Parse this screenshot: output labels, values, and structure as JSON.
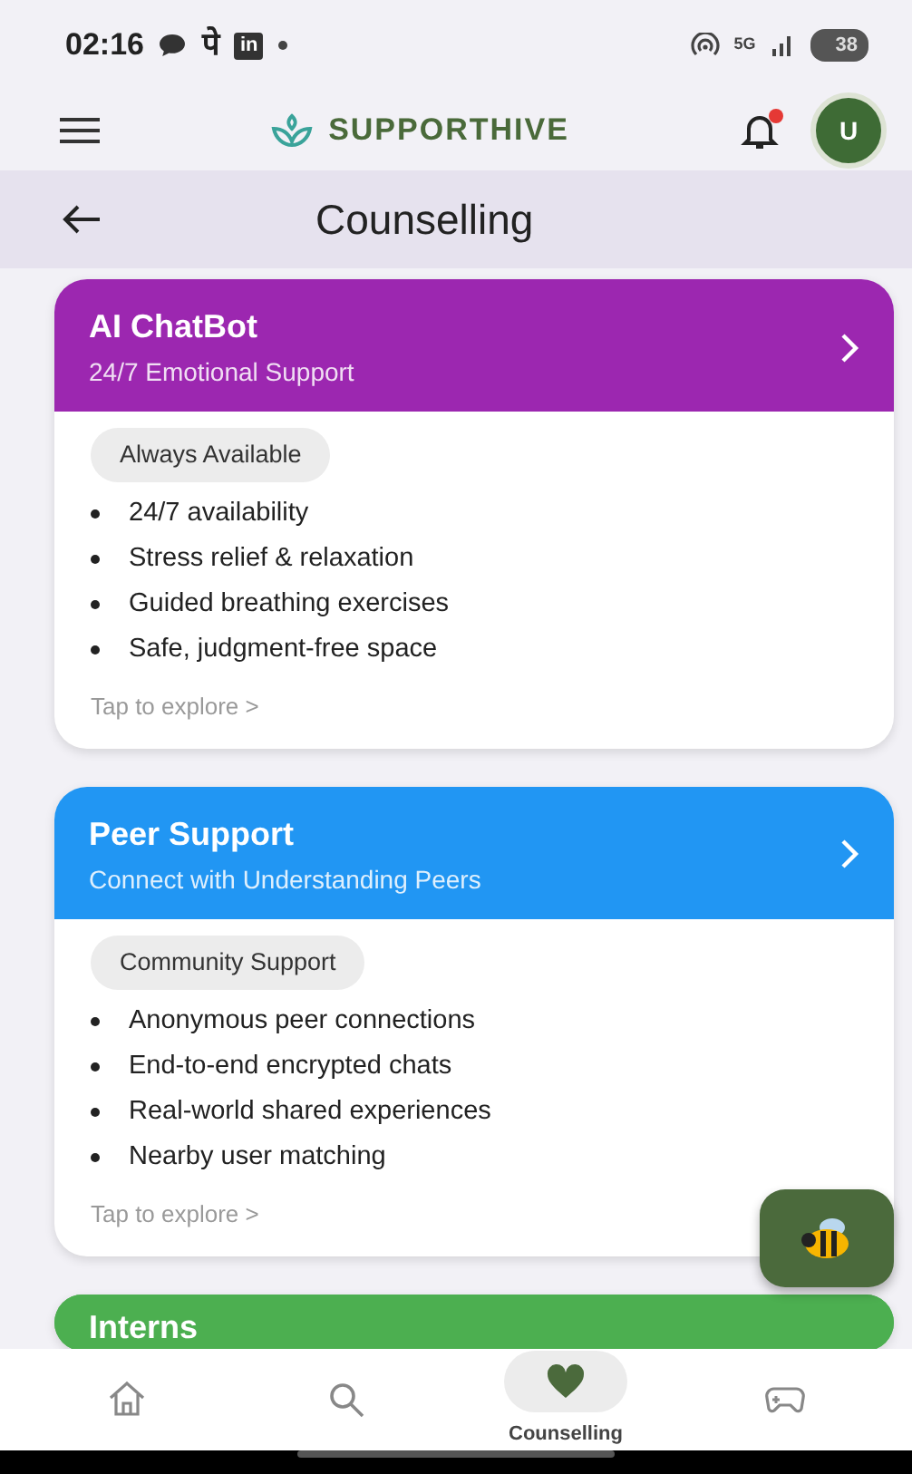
{
  "status_bar": {
    "time": "02:16",
    "app_label": "पे",
    "linkedin_label": "in",
    "network": "5G",
    "battery": "38"
  },
  "app_bar": {
    "brand": "SUPPORTHIVE",
    "has_notification": true,
    "avatar_initial": "U"
  },
  "title_bar": {
    "title": "Counselling"
  },
  "cards": [
    {
      "title": "AI ChatBot",
      "subtitle": "24/7 Emotional Support",
      "color": "#9c27b0",
      "tag": "Always Available",
      "features": [
        "24/7 availability",
        "Stress relief & relaxation",
        "Guided breathing exercises",
        "Safe, judgment-free space"
      ],
      "footer": "Tap to explore >"
    },
    {
      "title": "Peer Support",
      "subtitle": "Connect with Understanding Peers",
      "color": "#2196f3",
      "tag": "Community Support",
      "features": [
        "Anonymous peer connections",
        "End-to-end encrypted chats",
        "Real-world shared experiences",
        "Nearby user matching"
      ],
      "footer": "Tap to explore >"
    },
    {
      "title": "Interns",
      "color": "#4caf50"
    }
  ],
  "bottom_nav": [
    {
      "kind": "home",
      "selected": false
    },
    {
      "kind": "search",
      "selected": false
    },
    {
      "kind": "heart",
      "label": "Counselling",
      "selected": true
    },
    {
      "kind": "gamepad",
      "selected": false
    }
  ]
}
